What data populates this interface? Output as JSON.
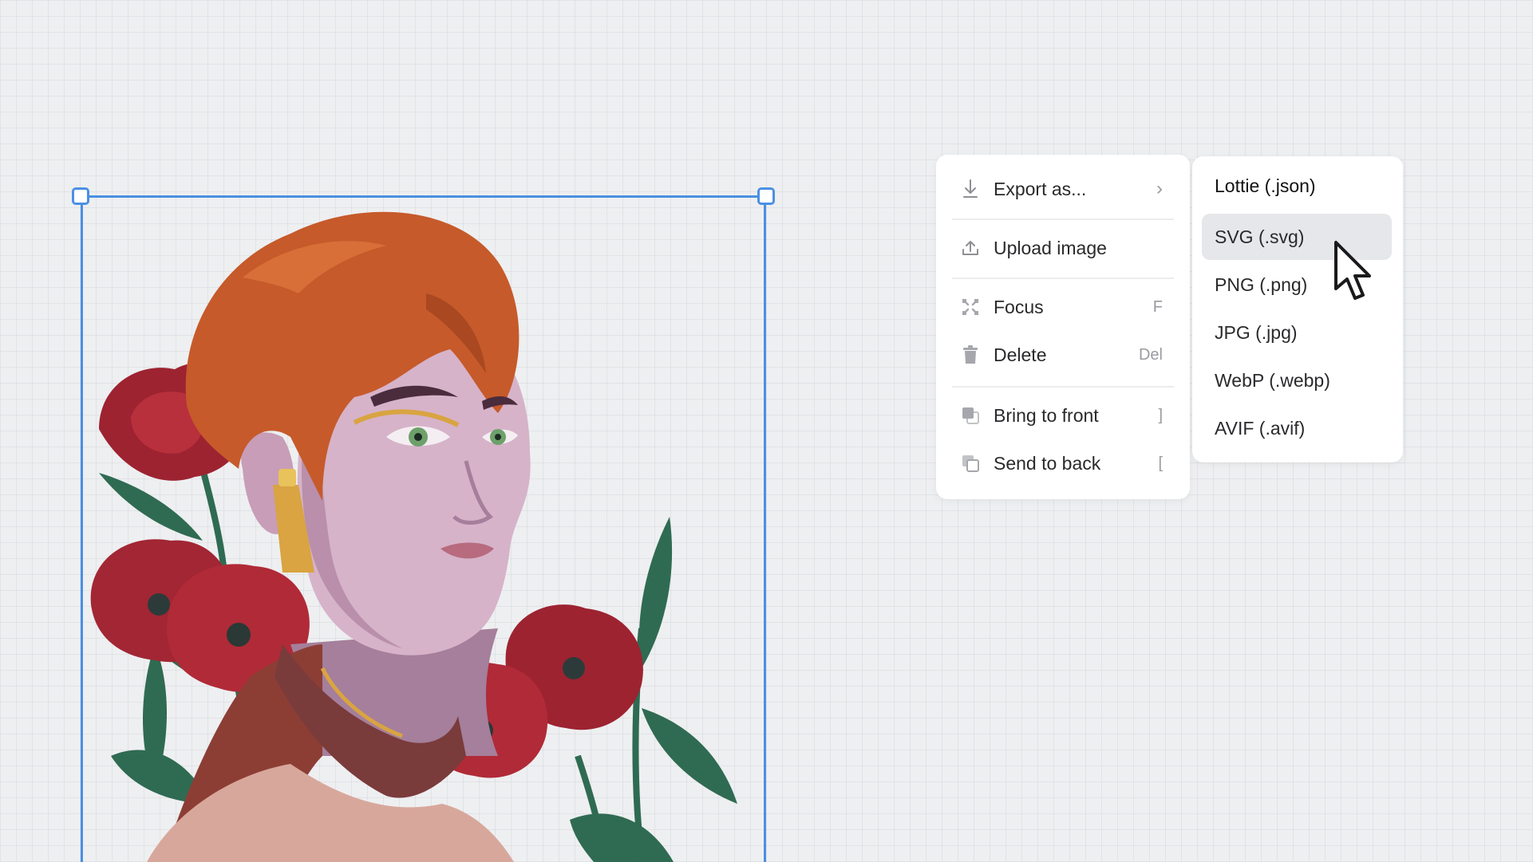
{
  "menu": {
    "items": [
      {
        "label": "Export as...",
        "shortcut": "",
        "icon": "download-icon",
        "has_submenu": true
      },
      {
        "label": "Upload image",
        "shortcut": "",
        "icon": "upload-icon"
      },
      {
        "label": "Focus",
        "shortcut": "F",
        "icon": "focus-icon"
      },
      {
        "label": "Delete",
        "shortcut": "Del",
        "icon": "trash-icon"
      },
      {
        "label": "Bring to front",
        "shortcut": "]",
        "icon": "bring-to-front-icon"
      },
      {
        "label": "Send to back",
        "shortcut": "[",
        "icon": "send-to-back-icon"
      }
    ],
    "submenu_chevron": "›"
  },
  "submenu": {
    "items": [
      {
        "label": "Lottie (.json)"
      },
      {
        "label": "SVG (.svg)",
        "active": true
      },
      {
        "label": "PNG (.png)"
      },
      {
        "label": "JPG (.jpg)"
      },
      {
        "label": "WebP (.webp)"
      },
      {
        "label": "AVIF (.avif)"
      }
    ]
  },
  "colors": {
    "selection": "#4a90e2",
    "canvas_bg": "#eeeff1",
    "menu_bg": "#ffffff",
    "hover_bg": "#e6e7ea"
  }
}
